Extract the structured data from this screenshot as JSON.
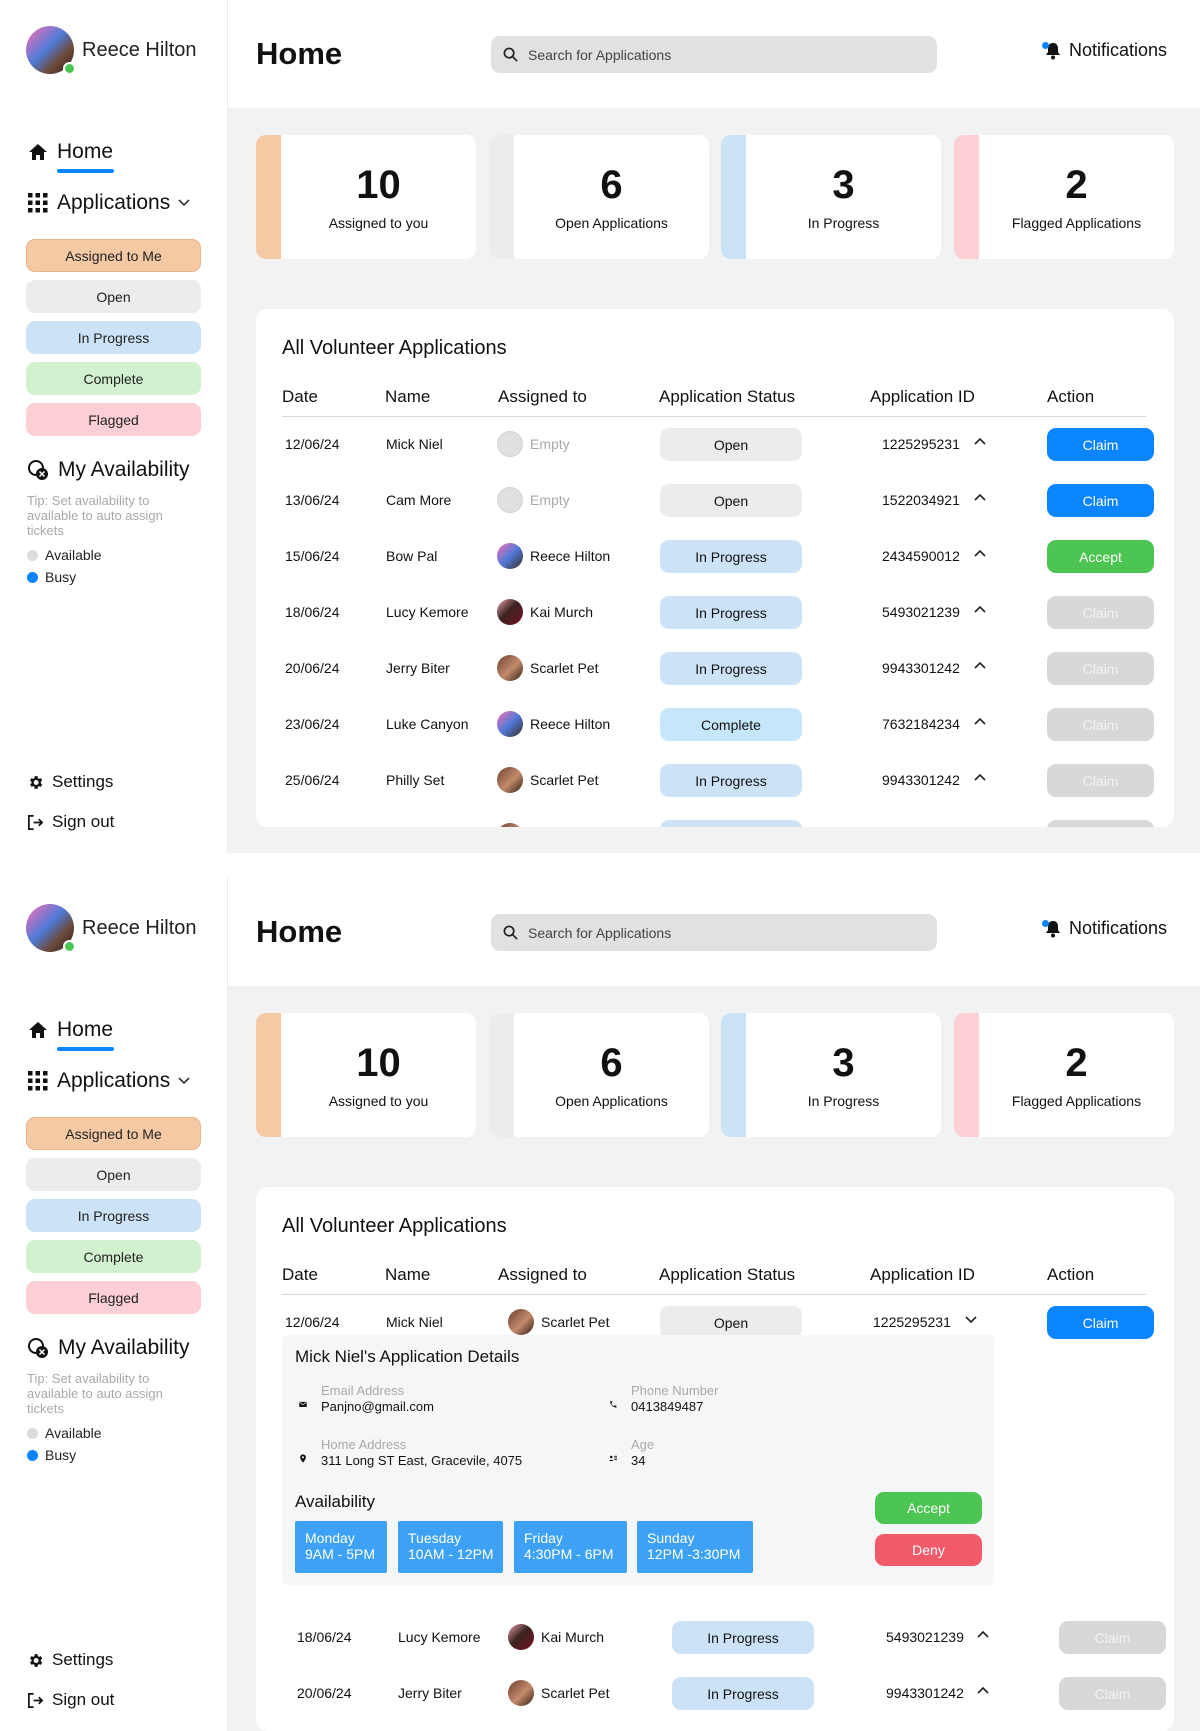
{
  "user": {
    "name": "Reece Hilton"
  },
  "header": {
    "title": "Home",
    "search_placeholder": "Search for Applications",
    "notifications_label": "Notifications"
  },
  "sidebar": {
    "home_label": "Home",
    "applications_label": "Applications",
    "filters": [
      {
        "label": "Assigned to Me",
        "color": "#f4c9a4"
      },
      {
        "label": "Open",
        "color": "#ececec"
      },
      {
        "label": "In Progress",
        "color": "#cce3f7"
      },
      {
        "label": "Complete",
        "color": "#d2f2cf"
      },
      {
        "label": "Flagged",
        "color": "#fbcfd3"
      }
    ],
    "availability": {
      "title": "My Availability",
      "tip": "Tip: Set availability to available to auto assign tickets",
      "options": [
        {
          "label": "Available",
          "color": "#dcdcdc"
        },
        {
          "label": "Busy",
          "color": "#0a84ff"
        }
      ]
    },
    "settings_label": "Settings",
    "signout_label": "Sign out"
  },
  "stats": [
    {
      "value": "10",
      "label": "Assigned to you",
      "color": "#f4c9a4"
    },
    {
      "value": "6",
      "label": "Open Applications",
      "color": "#ececec"
    },
    {
      "value": "3",
      "label": "In Progress",
      "color": "#cce3f7"
    },
    {
      "value": "2",
      "label": "Flagged Applications",
      "color": "#fbcfd3"
    }
  ],
  "table": {
    "title": "All Volunteer Applications",
    "columns": [
      "Date",
      "Name",
      "Assigned to",
      "Application Status",
      "Application ID",
      "Action"
    ]
  },
  "frame1_rows": [
    {
      "date": "12/06/24",
      "name": "Mick Niel",
      "assignee": "Empty",
      "status": "Open",
      "id": "1225295231",
      "action": "Claim"
    },
    {
      "date": "13/06/24",
      "name": "Cam More",
      "assignee": "Empty",
      "status": "Open",
      "id": "1522034921",
      "action": "Claim"
    },
    {
      "date": "15/06/24",
      "name": "Bow Pal",
      "assignee": "Reece Hilton",
      "status": "In Progress",
      "id": "2434590012",
      "action": "Accept"
    },
    {
      "date": "18/06/24",
      "name": "Lucy Kemore",
      "assignee": "Kai Murch",
      "status": "In Progress",
      "id": "5493021239",
      "action": "Claim"
    },
    {
      "date": "20/06/24",
      "name": "Jerry Biter",
      "assignee": "Scarlet Pet",
      "status": "In Progress",
      "id": "9943301242",
      "action": "Claim"
    },
    {
      "date": "23/06/24",
      "name": "Luke Canyon",
      "assignee": "Reece Hilton",
      "status": "Complete",
      "id": "7632184234",
      "action": "Claim"
    },
    {
      "date": "25/06/24",
      "name": "Philly Set",
      "assignee": "Scarlet Pet",
      "status": "In Progress",
      "id": "9943301242",
      "action": "Claim"
    }
  ],
  "frame2_rows": [
    {
      "date": "12/06/24",
      "name": "Mick Niel",
      "assignee": "Scarlet Pet",
      "status": "Open",
      "id": "1225295231",
      "action": "Claim"
    },
    {
      "date": "18/06/24",
      "name": "Lucy Kemore",
      "assignee": "Kai Murch",
      "status": "In Progress",
      "id": "5493021239",
      "action": "Claim"
    },
    {
      "date": "20/06/24",
      "name": "Jerry Biter",
      "assignee": "Scarlet Pet",
      "status": "In Progress",
      "id": "9943301242",
      "action": "Claim"
    }
  ],
  "details": {
    "title": "Mick Niel's Application Details",
    "email_label": "Email Address",
    "email": "Panjno@gmail.com",
    "phone_label": "Phone Number",
    "phone": "0413849487",
    "address_label": "Home Address",
    "address": "311 Long ST East, Gracevile, 4075",
    "age_label": "Age",
    "age": "34",
    "availability_title": "Availability",
    "days": [
      {
        "day": "Monday",
        "time": "9AM - 5PM"
      },
      {
        "day": "Tuesday",
        "time": "10AM - 12PM"
      },
      {
        "day": "Friday",
        "time": "4:30PM - 6PM"
      },
      {
        "day": "Sunday",
        "time": "12PM -3:30PM"
      }
    ],
    "accept_label": "Accept",
    "deny_label": "Deny"
  },
  "colors": {
    "accent": "#0a84ff",
    "accept_green": "#4cc552",
    "deny_red": "#f25a6a",
    "status_open": "#ececec",
    "status_in_progress": "#cce3f7",
    "status_complete": "#c6e7fb",
    "disabled_button": "#d8d8d8",
    "availability_day": "#3da2f5"
  },
  "icons": [
    "home-icon",
    "grid-icon",
    "chevron-down-icon",
    "availability-icon",
    "gear-icon",
    "sign-out-icon",
    "search-icon",
    "bell-icon",
    "chevron-up-icon",
    "mail-icon",
    "phone-icon",
    "location-icon",
    "id-card-icon"
  ]
}
